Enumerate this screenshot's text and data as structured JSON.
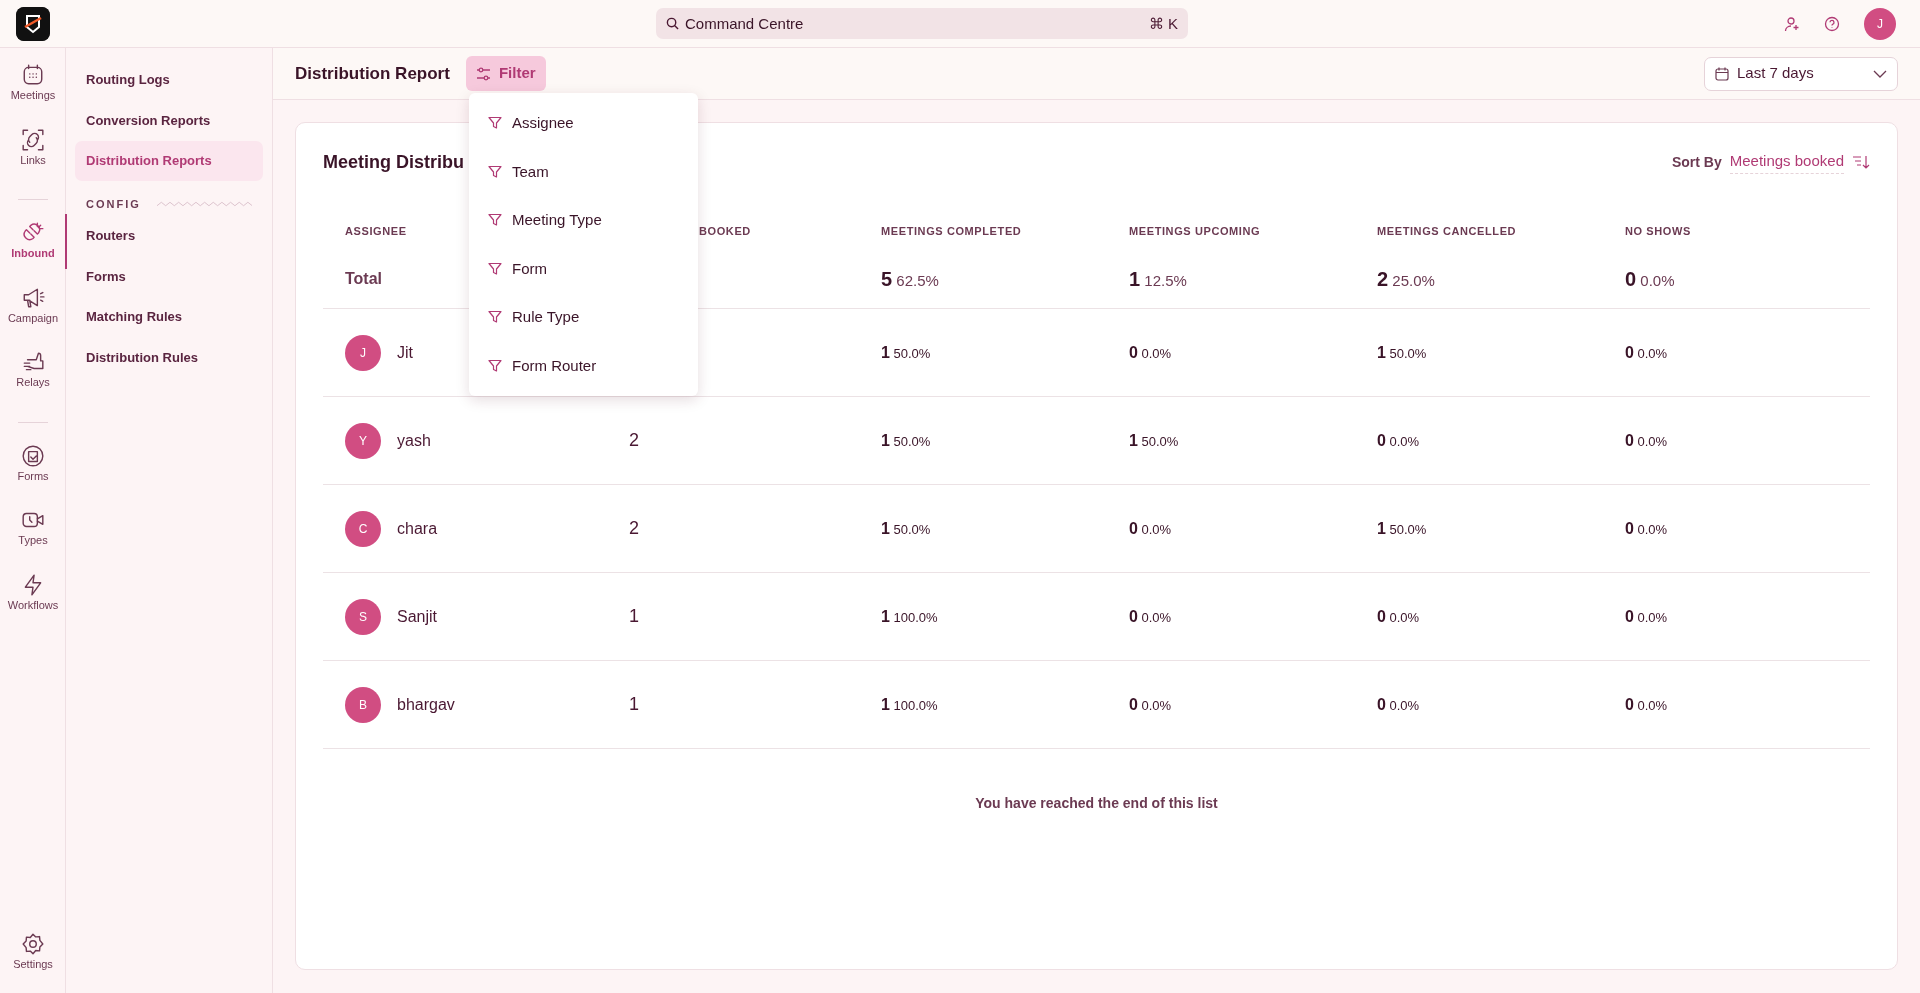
{
  "topbar": {
    "search": {
      "placeholder": "Command Centre",
      "shortcut": "⌘ K"
    },
    "avatar": "J"
  },
  "rail": {
    "items": [
      {
        "label": "Meetings",
        "selected": false
      },
      {
        "label": "Links",
        "selected": false
      },
      {
        "label": "Inbound",
        "selected": true
      },
      {
        "label": "Campaign",
        "selected": false
      },
      {
        "label": "Relays",
        "selected": false
      },
      {
        "label": "Forms",
        "selected": false
      },
      {
        "label": "Types",
        "selected": false
      },
      {
        "label": "Workflows",
        "selected": false
      }
    ],
    "bottom": {
      "label": "Settings"
    }
  },
  "sidebar": {
    "items": [
      {
        "label": "Routing Logs",
        "selected": false
      },
      {
        "label": "Conversion Reports",
        "selected": false
      },
      {
        "label": "Distribution Reports",
        "selected": true
      }
    ],
    "section": "CONFIG",
    "config_items": [
      {
        "label": "Routers",
        "selected": false
      },
      {
        "label": "Forms",
        "selected": false
      },
      {
        "label": "Matching Rules",
        "selected": false
      },
      {
        "label": "Distribution Rules",
        "selected": false
      }
    ]
  },
  "header": {
    "title": "Distribution Report",
    "filter": {
      "label": "Filter",
      "expanded": true
    },
    "range": "Last 7 days"
  },
  "filter_menu": [
    "Assignee",
    "Team",
    "Meeting Type",
    "Form",
    "Rule Type",
    "Form Router"
  ],
  "card": {
    "title": "Meeting Distribu",
    "sort_label": "Sort By",
    "sort_value": "Meetings booked",
    "columns": [
      "ASSIGNEE",
      "BOOKED",
      "MEETINGS COMPLETED",
      "MEETINGS UPCOMING",
      "MEETINGS CANCELLED",
      "NO SHOWS"
    ],
    "total": {
      "label": "Total",
      "stats": [
        [
          "5",
          "62.5%"
        ],
        [
          "1",
          "12.5%"
        ],
        [
          "2",
          "25.0%"
        ],
        [
          "0",
          "0.0%"
        ]
      ]
    },
    "rows": [
      {
        "initial": "J",
        "name": "Jit",
        "stats": [
          [
            "1",
            "50.0%"
          ],
          [
            "0",
            "0.0%"
          ],
          [
            "1",
            "50.0%"
          ],
          [
            "0",
            "0.0%"
          ]
        ]
      },
      {
        "initial": "Y",
        "name": "yash",
        "booked": "2",
        "stats": [
          [
            "1",
            "50.0%"
          ],
          [
            "1",
            "50.0%"
          ],
          [
            "0",
            "0.0%"
          ],
          [
            "0",
            "0.0%"
          ]
        ]
      },
      {
        "initial": "C",
        "name": "chara",
        "booked": "2",
        "stats": [
          [
            "1",
            "50.0%"
          ],
          [
            "0",
            "0.0%"
          ],
          [
            "1",
            "50.0%"
          ],
          [
            "0",
            "0.0%"
          ]
        ]
      },
      {
        "initial": "S",
        "name": "Sanjit",
        "booked": "1",
        "stats": [
          [
            "1",
            "100.0%"
          ],
          [
            "0",
            "0.0%"
          ],
          [
            "0",
            "0.0%"
          ],
          [
            "0",
            "0.0%"
          ]
        ]
      },
      {
        "initial": "B",
        "name": "bhargav",
        "booked": "1",
        "stats": [
          [
            "1",
            "100.0%"
          ],
          [
            "0",
            "0.0%"
          ],
          [
            "0",
            "0.0%"
          ],
          [
            "0",
            "0.0%"
          ]
        ]
      }
    ],
    "footer": "You have reached the end of this list"
  }
}
